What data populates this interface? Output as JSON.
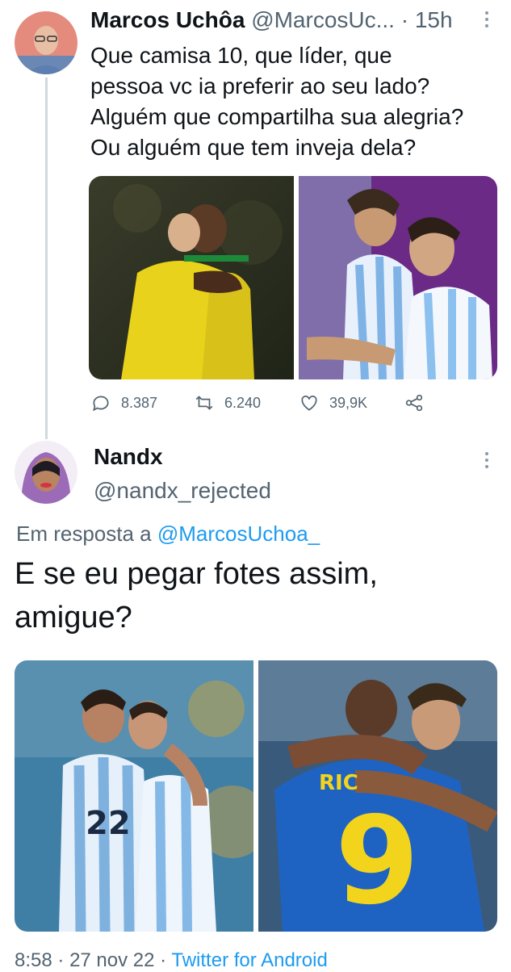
{
  "tweet1": {
    "author_name": "Marcos Uchôa",
    "author_handle": "@MarcosUc...",
    "separator": "·",
    "time": "15h",
    "text_lines": [
      "Que camisa 10, que líder, que",
      "pessoa vc ia preferir ao seu lado?",
      "Alguém que compartilha sua alegria?",
      "Ou alguém que tem inveja dela?"
    ],
    "images": [
      {
        "icon": "photo-brazil-players-hugging"
      },
      {
        "icon": "photo-argentina-players-celebrating"
      }
    ],
    "actions": {
      "replies": "8.387",
      "retweets": "6.240",
      "likes": "39,9K"
    }
  },
  "tweet2": {
    "author_name": "Nandx",
    "author_handle": "@nandx_rejected",
    "reply_prefix": "Em resposta a",
    "reply_handle": "@MarcosUchoa_",
    "text_lines": [
      "E se eu pegar fotes assim,",
      "amigue?"
    ],
    "images": [
      {
        "icon": "photo-argentina-players-hugging"
      },
      {
        "icon": "photo-brazil-number-9-hug"
      }
    ],
    "footer": {
      "time": "8:58",
      "date": "27 nov 22",
      "source": "Twitter for Android"
    }
  },
  "colors": {
    "text": "#0f1419",
    "muted": "#536471",
    "link": "#1d9bf0",
    "divider": "#cfd9de"
  }
}
